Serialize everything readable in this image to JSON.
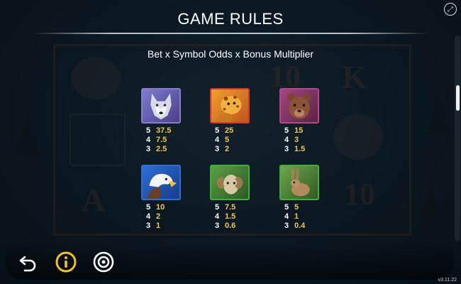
{
  "header": {
    "title": "GAME RULES",
    "formula": "Bet x Symbol Odds x Bonus Multiplier"
  },
  "background": {
    "symbols": [
      "10",
      "K",
      "A",
      "10"
    ]
  },
  "paytable": [
    {
      "name": "Wolf",
      "icon": "wolf-symbol-icon",
      "border": "#8a7cc6",
      "odds": [
        {
          "count": "5",
          "value": "37.5"
        },
        {
          "count": "4",
          "value": "7.5"
        },
        {
          "count": "3",
          "value": "2.5"
        }
      ]
    },
    {
      "name": "Leopard",
      "icon": "leopard-symbol-icon",
      "border": "#d8352a",
      "odds": [
        {
          "count": "5",
          "value": "25"
        },
        {
          "count": "4",
          "value": "5"
        },
        {
          "count": "3",
          "value": "2"
        }
      ]
    },
    {
      "name": "Bear",
      "icon": "bear-symbol-icon",
      "border": "#b04a86",
      "odds": [
        {
          "count": "5",
          "value": "15"
        },
        {
          "count": "4",
          "value": "3"
        },
        {
          "count": "3",
          "value": "1.5"
        }
      ]
    },
    {
      "name": "Eagle",
      "icon": "eagle-symbol-icon",
      "border": "#2f6fd0",
      "odds": [
        {
          "count": "5",
          "value": "10"
        },
        {
          "count": "4",
          "value": "2"
        },
        {
          "count": "3",
          "value": "1"
        }
      ]
    },
    {
      "name": "Ram",
      "icon": "ram-symbol-icon",
      "border": "#3fae3f",
      "odds": [
        {
          "count": "5",
          "value": "7.5"
        },
        {
          "count": "4",
          "value": "1.5"
        },
        {
          "count": "3",
          "value": "0.6"
        }
      ]
    },
    {
      "name": "Rabbit",
      "icon": "rabbit-symbol-icon",
      "border": "#3fae3f",
      "odds": [
        {
          "count": "5",
          "value": "5"
        },
        {
          "count": "4",
          "value": "1"
        },
        {
          "count": "3",
          "value": "0.4"
        }
      ]
    }
  ],
  "colors": {
    "odds_value": "#f0c84a",
    "info_button": "#f3c21c",
    "text": "#ffffff"
  },
  "controls": {
    "back": "back-arrow-icon",
    "info": "info-icon",
    "settings": "settings-icon",
    "expand": "expand-icon"
  },
  "version": "v3.11.22"
}
